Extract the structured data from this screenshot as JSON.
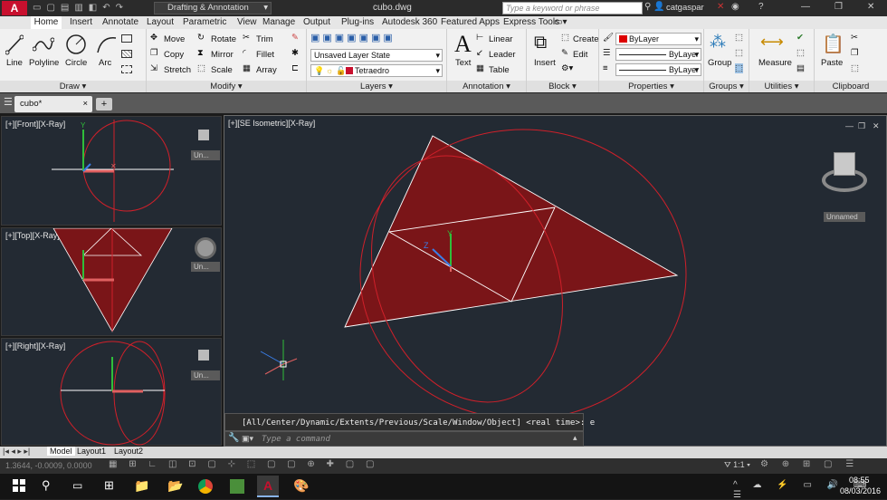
{
  "titlebar": {
    "workspace": "Drafting & Annotation",
    "filename": "cubo.dwg",
    "search_placeholder": "Type a keyword or phrase",
    "user": "catgaspar"
  },
  "tabs": [
    "Home",
    "Insert",
    "Annotate",
    "Layout",
    "Parametric",
    "View",
    "Manage",
    "Output",
    "Plug-ins",
    "Autodesk 360",
    "Featured Apps",
    "Express Tools"
  ],
  "ribbon": {
    "draw": {
      "title": "Draw",
      "line": "Line",
      "polyline": "Polyline",
      "circle": "Circle",
      "arc": "Arc"
    },
    "modify": {
      "title": "Modify",
      "move": "Move",
      "copy": "Copy",
      "stretch": "Stretch",
      "rotate": "Rotate",
      "mirror": "Mirror",
      "scale": "Scale",
      "trim": "Trim",
      "fillet": "Fillet",
      "array": "Array"
    },
    "layers": {
      "title": "Layers",
      "layer_state": "Unsaved Layer State",
      "current_layer": "Tetraedro"
    },
    "annotation": {
      "title": "Annotation",
      "text": "Text",
      "linear": "Linear",
      "leader": "Leader",
      "table": "Table"
    },
    "block": {
      "title": "Block",
      "insert": "Insert",
      "create": "Create",
      "edit": "Edit"
    },
    "properties": {
      "title": "Properties",
      "color": "ByLayer",
      "linetype": "ByLayer",
      "lineweight": "ByLayer"
    },
    "groups": {
      "title": "Groups",
      "group": "Group"
    },
    "utilities": {
      "title": "Utilities",
      "measure": "Measure"
    },
    "clipboard": {
      "title": "Clipboard",
      "paste": "Paste"
    }
  },
  "doc_tab": "cubo*",
  "viewports": {
    "front": {
      "label": "[+][Front][X-Ray]",
      "view_name": "Un..."
    },
    "top": {
      "label": "[+][Top][X-Ray]",
      "view_name": "Un..."
    },
    "right": {
      "label": "[+][Right][X-Ray]",
      "view_name": "Un..."
    },
    "main": {
      "label": "[+][SE Isometric][X-Ray]",
      "view_name": "Unnamed"
    }
  },
  "command": {
    "history": "[All/Center/Dynamic/Extents/Previous/Scale/Window/Object] <real time>: e",
    "placeholder": "Type a command"
  },
  "layout_tabs": [
    "Model",
    "Layout1",
    "Layout2"
  ],
  "status": {
    "coords": "1.3644, -0.0009, 0.0000",
    "scale": "1:1"
  },
  "taskbar": {
    "time": "08:55",
    "date": "08/03/2016"
  },
  "colors": {
    "accent": "#c8102e",
    "shape_fill": "#7a1518",
    "circle_stroke": "#d0202a",
    "edge": "#ffffff",
    "viewport_bg": "#232a33"
  }
}
